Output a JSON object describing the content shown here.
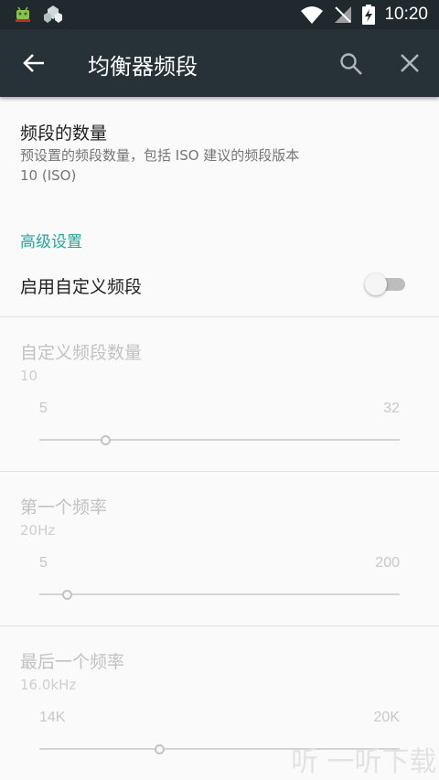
{
  "status_bar": {
    "time": "10:20",
    "icons": [
      "android-debug-icon",
      "app-notification-icon",
      "wifi-icon",
      "no-signal-icon",
      "battery-charging-icon"
    ]
  },
  "app_bar": {
    "title": "均衡器频段",
    "icons": [
      "back-arrow-icon",
      "search-icon",
      "close-icon"
    ]
  },
  "bands": {
    "title": "频段的数量",
    "summary_line1": "预设置的频段数量，包括 ISO 建议的频段版本",
    "summary_line2": "10 (ISO)"
  },
  "advanced": {
    "header": "高级设置",
    "custom_bands_label": "启用自定义频段",
    "custom_bands_enabled": false
  },
  "custom_band_count": {
    "title": "自定义频段数量",
    "value": "10",
    "min": "5",
    "max": "32",
    "fraction": 0.185
  },
  "first_frequency": {
    "title": "第一个频率",
    "value": "20Hz",
    "min": "5",
    "max": "200",
    "fraction": 0.077
  },
  "last_frequency": {
    "title": "最后一个频率",
    "value": "16.0kHz",
    "min": "14K",
    "max": "20K",
    "fraction": 0.333
  },
  "watermark": "听 一听下载",
  "colors": {
    "app_bar": "#263238",
    "status_bar": "#20292e",
    "accent": "#26a69a"
  }
}
